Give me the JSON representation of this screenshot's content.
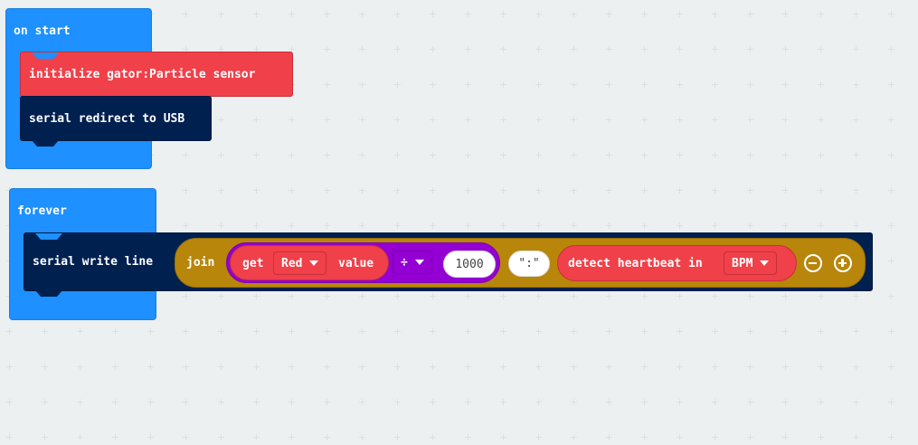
{
  "colors": {
    "background": "#ecf0f1",
    "event_block": "#1e90ff",
    "sensor_block": "#f0404a",
    "serial_block": "#002050",
    "text_join": "#b8860b",
    "math_block": "#9400d3"
  },
  "on_start": {
    "label": "on start",
    "statements": [
      {
        "label": "initialize gator:Particle sensor"
      },
      {
        "label": "serial redirect to USB"
      }
    ]
  },
  "forever": {
    "label": "forever",
    "serial_write_line": {
      "label": "serial write line",
      "join": {
        "label": "join",
        "math": {
          "get_value": {
            "prefix": "get",
            "channel": "Red",
            "suffix": "value"
          },
          "operator": "÷",
          "operand": "1000"
        },
        "text_value": "\":\"",
        "heartbeat": {
          "label": "detect heartbeat in",
          "unit": "BPM"
        },
        "remove_icon": "minus-circle-icon",
        "add_icon": "plus-circle-icon"
      }
    }
  }
}
